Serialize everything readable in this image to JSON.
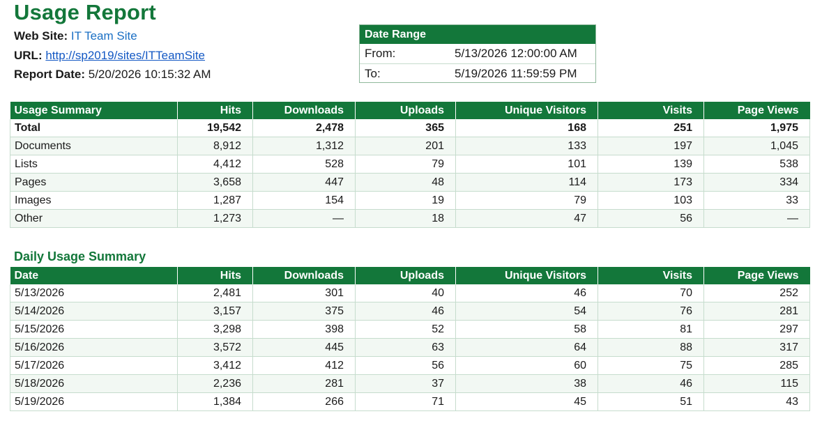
{
  "report": {
    "title": "Usage Report",
    "web_site_label": "Web Site:",
    "web_site": "IT Team Site",
    "url_label": "URL:",
    "url": "http://sp2019/sites/ITTeamSite",
    "report_date_label": "Report Date:",
    "report_date": "5/20/2026 10:15:32 AM"
  },
  "date_range": {
    "header": "Date Range",
    "from_label": "From:",
    "from": "5/13/2026 12:00:00 AM",
    "to_label": "To:",
    "to": "5/19/2026 11:59:59 PM"
  },
  "usage_summary": {
    "columns": [
      "Usage Summary",
      "Hits",
      "Downloads",
      "Uploads",
      "Unique Visitors",
      "Visits",
      "Page Views"
    ],
    "rows": [
      [
        "Total",
        "19,542",
        "2,478",
        "365",
        "168",
        "251",
        "1,975"
      ],
      [
        "Documents",
        "8,912",
        "1,312",
        "201",
        "133",
        "197",
        "1,045"
      ],
      [
        "Lists",
        "4,412",
        "528",
        "79",
        "101",
        "139",
        "538"
      ],
      [
        "Pages",
        "3,658",
        "447",
        "48",
        "114",
        "173",
        "334"
      ],
      [
        "Images",
        "1,287",
        "154",
        "19",
        "79",
        "103",
        "33"
      ],
      [
        "Other",
        "1,273",
        "—",
        "18",
        "47",
        "56",
        "—"
      ]
    ]
  },
  "daily_usage": {
    "title": "Daily Usage Summary",
    "columns": [
      "Date",
      "Hits",
      "Downloads",
      "Uploads",
      "Unique Visitors",
      "Visits",
      "Page Views"
    ],
    "rows": [
      [
        "5/13/2026",
        "2,481",
        "301",
        "40",
        "46",
        "70",
        "252"
      ],
      [
        "5/14/2026",
        "3,157",
        "375",
        "46",
        "54",
        "76",
        "281"
      ],
      [
        "5/15/2026",
        "3,298",
        "398",
        "52",
        "58",
        "81",
        "297"
      ],
      [
        "5/16/2026",
        "3,572",
        "445",
        "63",
        "64",
        "88",
        "317"
      ],
      [
        "5/17/2026",
        "3,412",
        "412",
        "56",
        "60",
        "75",
        "285"
      ],
      [
        "5/18/2026",
        "2,236",
        "281",
        "37",
        "38",
        "46",
        "115"
      ],
      [
        "5/19/2026",
        "1,384",
        "266",
        "71",
        "45",
        "51",
        "43"
      ]
    ]
  },
  "colors": {
    "accent_green": "#13773a",
    "link_blue": "#1358c4",
    "row_stripe": "#f2f8f3"
  }
}
